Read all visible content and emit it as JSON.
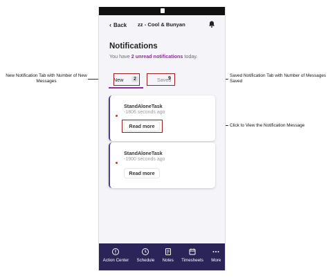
{
  "annotations": {
    "new_tab_note": "New Notification Tab with Number of New Messages",
    "saved_tab_note": "Saved Notification Tab with Number of Messages Saved",
    "read_more_note": "Click to View the Notification Message"
  },
  "header": {
    "back_label": "Back",
    "title": "zz - Cool & Bunyan",
    "bell_icon": "bell-icon"
  },
  "page": {
    "title": "Notifications",
    "subtitle_prefix": "You have ",
    "subtitle_highlight": "2 unread notifications",
    "subtitle_suffix": " today."
  },
  "tabs": [
    {
      "label": "New",
      "count": "2"
    },
    {
      "label": "Saved",
      "count": "9"
    }
  ],
  "notifications": [
    {
      "title": "StandAloneTask",
      "time": "-1806 seconds ago",
      "button": "Read more"
    },
    {
      "title": "StandAloneTask",
      "time": "-1900 seconds ago",
      "button": "Read more"
    }
  ],
  "bottom_nav": [
    {
      "label": "Action Center",
      "icon": "alert-circle-icon"
    },
    {
      "label": "Schedule",
      "icon": "clock-icon"
    },
    {
      "label": "Notes",
      "icon": "notes-icon"
    },
    {
      "label": "Timesheets",
      "icon": "calendar-icon"
    },
    {
      "label": "More",
      "icon": "more-dots-icon"
    }
  ],
  "colors": {
    "accent": "#8b2f97",
    "nav_background": "#2b2459",
    "annotation_box": "#9b1c1c",
    "unread_dot": "#c0392b"
  }
}
